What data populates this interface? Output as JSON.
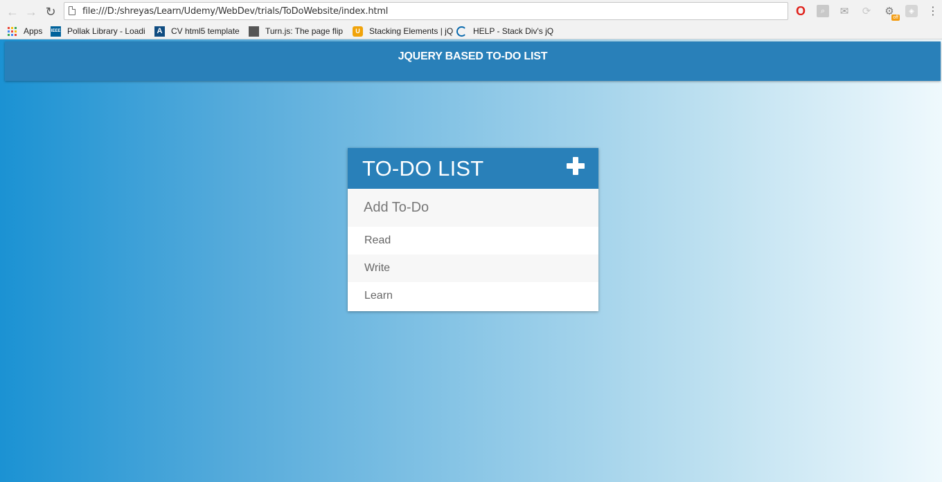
{
  "browser": {
    "url": "file:///D:/shreyas/Learn/Udemy/WebDev/trials/ToDoWebsite/index.html",
    "nav_icons": {
      "back": "←",
      "forward": "→",
      "reload": "↻"
    },
    "extensions": [
      {
        "name": "opera-icon",
        "glyph": "O"
      },
      {
        "name": "pdf-icon",
        "glyph": "⌕"
      },
      {
        "name": "mail-icon",
        "glyph": "✉"
      },
      {
        "name": "sync-icon",
        "glyph": "⟳"
      },
      {
        "name": "bot-icon",
        "glyph": "⚙",
        "badge": "off"
      },
      {
        "name": "extension-icon",
        "glyph": "◈"
      }
    ],
    "menu_glyph": "⋮"
  },
  "bookmarks": [
    {
      "label": "Apps",
      "icon": "apps-grid-icon"
    },
    {
      "label": "Pollak Library - Loadi",
      "icon": "ieee-icon",
      "icon_text": "IEEE",
      "icon_color": "#00629b"
    },
    {
      "label": "CV html5 template",
      "icon": "cv-template-icon",
      "icon_text": "A",
      "icon_color": "#0f4c81"
    },
    {
      "label": "Turn.js: The page flip",
      "icon": "turnjs-icon",
      "icon_text": "",
      "icon_color": "#555555"
    },
    {
      "label": "Stacking Elements | jQ",
      "icon": "stacking-elements-icon",
      "icon_text": "U",
      "icon_color": "#f0a30a"
    },
    {
      "label": "HELP - Stack Div's jQ",
      "icon": "jquery-icon",
      "icon_text": "",
      "icon_color": "#0769ad"
    }
  ],
  "app": {
    "header_title": "JQUERY BASED TO-DO LIST",
    "todo": {
      "title": "TO-DO LIST",
      "add_icon": "plus-icon",
      "input_placeholder": "Add To-Do",
      "items": [
        "Read",
        "Write",
        "Learn"
      ]
    }
  },
  "colors": {
    "header_blue": "#2980b9",
    "gradient_start": "#1b92d3",
    "gradient_end": "#eff9fd",
    "item_alt_bg": "#f7f7f7"
  }
}
